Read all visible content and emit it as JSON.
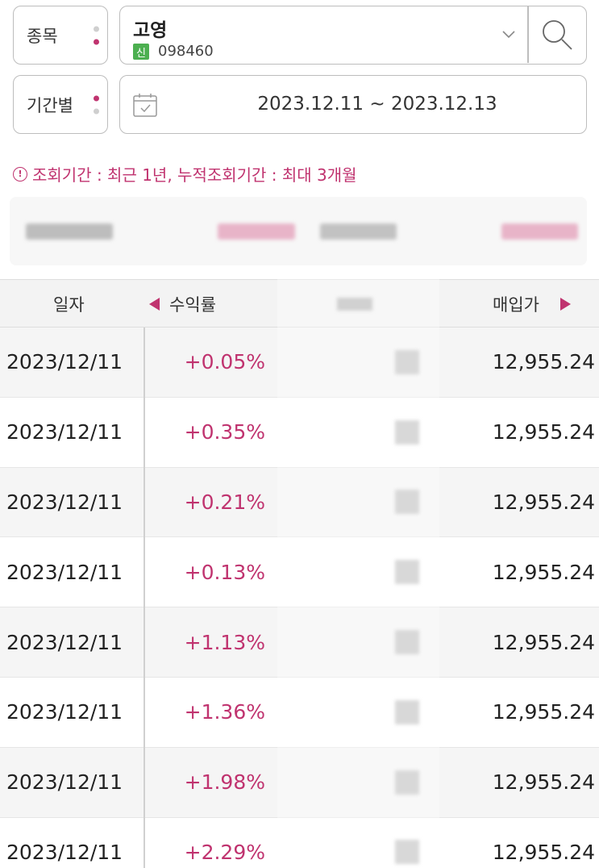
{
  "stock": {
    "label": "종목",
    "name": "고영",
    "badge": "신",
    "code": "098460"
  },
  "period": {
    "label": "기간별",
    "range": "2023.12.11 ~ 2023.12.13"
  },
  "notice": "조회기간 : 최근 1년, 누적조회기간 : 최대 3개월",
  "table": {
    "headers": {
      "date": "일자",
      "rate": "수익률",
      "buy_price": "매입가"
    },
    "rows": [
      {
        "date": "2023/12/11",
        "rate": "+0.05%",
        "buy_price": "12,955.24"
      },
      {
        "date": "2023/12/11",
        "rate": "+0.35%",
        "buy_price": "12,955.24"
      },
      {
        "date": "2023/12/11",
        "rate": "+0.21%",
        "buy_price": "12,955.24"
      },
      {
        "date": "2023/12/11",
        "rate": "+0.13%",
        "buy_price": "12,955.24"
      },
      {
        "date": "2023/12/11",
        "rate": "+1.13%",
        "buy_price": "12,955.24"
      },
      {
        "date": "2023/12/11",
        "rate": "+1.36%",
        "buy_price": "12,955.24"
      },
      {
        "date": "2023/12/11",
        "rate": "+1.98%",
        "buy_price": "12,955.24"
      },
      {
        "date": "2023/12/11",
        "rate": "+2.29%",
        "buy_price": "12,955.24"
      }
    ]
  },
  "colors": {
    "accent": "#c0336f",
    "badge": "#4caf50",
    "border": "#bdbdbd"
  },
  "icons": [
    "chevron-down-icon",
    "search-icon",
    "calendar-icon",
    "info-icon",
    "arrow-left-icon",
    "arrow-right-icon"
  ]
}
